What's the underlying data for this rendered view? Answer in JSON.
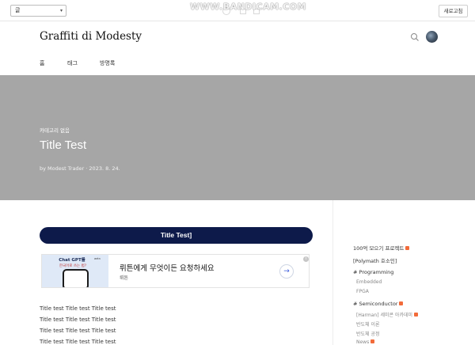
{
  "editor_bar": {
    "select_value": "글",
    "refresh_label": "새로고침",
    "watermark": "WWW.BANDICAM.COM"
  },
  "blog": {
    "title": "Graffiti di Modesty",
    "nav": [
      "홈",
      "태그",
      "방명록"
    ]
  },
  "post": {
    "category": "카테고리 없음",
    "title": "Title Test",
    "meta": "by Modest Trader · 2023. 8. 24.",
    "heading": "Title Test]",
    "body_lines": [
      "Title test Title test Title test",
      "Title test Title test Title test",
      "Title test Title test Title test",
      "Title test Title test Title test"
    ]
  },
  "ad": {
    "image_title": "Chat GPT를",
    "image_title2": "한국어로 쓰는 법?",
    "image_brand": "wrtn",
    "headline": "뤼튼에게 무엇이든 요청하세요",
    "advertiser": "뤼튼",
    "info": "i",
    "arrow": "→"
  },
  "sidebar": {
    "items": [
      {
        "label": "100억 모으기 프로젝트",
        "badge": true
      },
      {
        "label": "[Polymath 호소인]",
        "badge": false
      },
      {
        "label": "# Programming",
        "badge": false
      },
      {
        "label": "Embedded",
        "badge": false
      },
      {
        "label": "FPGA",
        "badge": false
      },
      {
        "label": "# Semiconductor",
        "badge": true
      },
      {
        "label": "[Harman] 세미콘 아카데미",
        "badge": true
      },
      {
        "label": "반도체 이론",
        "badge": false
      },
      {
        "label": "반도체 공정",
        "badge": false
      },
      {
        "label": "News",
        "badge": true
      }
    ]
  },
  "colors": {
    "hero_bg": "#a6a6a6",
    "heading_pill": "#0d1a4a",
    "badge": "#f26b3a"
  }
}
